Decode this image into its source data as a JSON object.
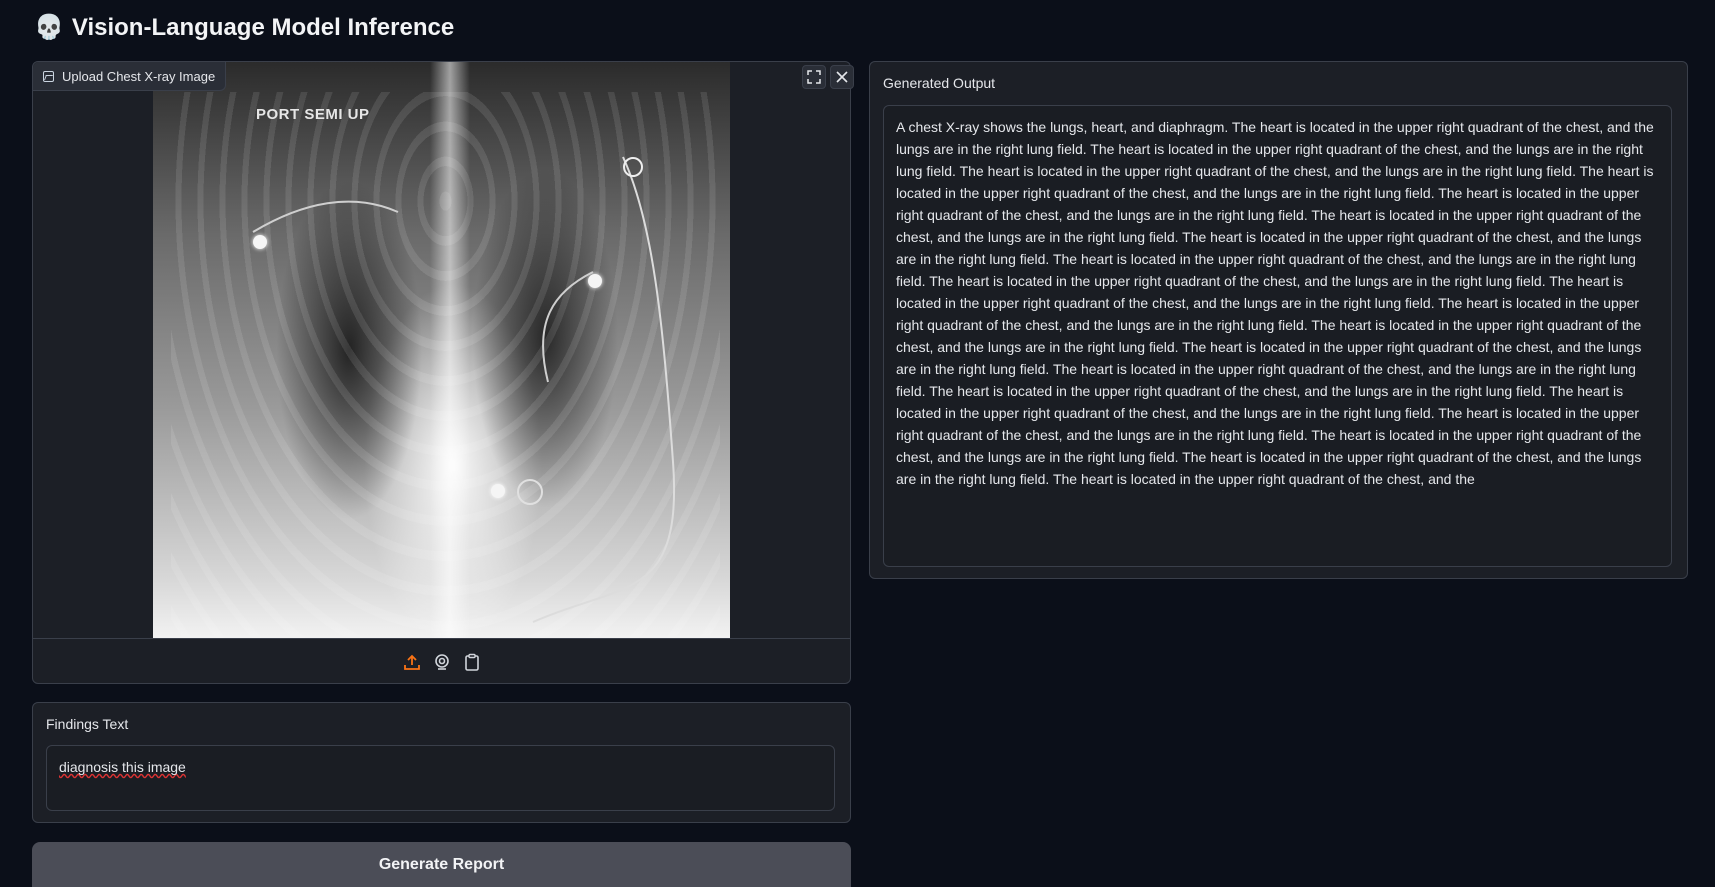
{
  "header": {
    "icon": "skull-icon",
    "title": "Vision-Language Model Inference"
  },
  "image_upload": {
    "label": "Upload Chest X-ray Image",
    "image_marker_text": "PORT SEMI UP",
    "toolbar_icons": [
      "upload-icon",
      "webcam-icon",
      "clipboard-icon"
    ],
    "accent_color": "#f97316"
  },
  "findings": {
    "label": "Findings Text",
    "value": "diagnosis this image"
  },
  "generate_button": {
    "label": "Generate Report"
  },
  "output": {
    "label": "Generated Output",
    "text": " A chest X-ray shows the lungs, heart, and diaphragm. The heart is located in the upper right quadrant of the chest, and the lungs are in the right lung field. The heart is located in the upper right quadrant of the chest, and the lungs are in the right lung field. The heart is located in the upper right quadrant of the chest, and the lungs are in the right lung field. The heart is located in the upper right quadrant of the chest, and the lungs are in the right lung field. The heart is located in the upper right quadrant of the chest, and the lungs are in the right lung field. The heart is located in the upper right quadrant of the chest, and the lungs are in the right lung field. The heart is located in the upper right quadrant of the chest, and the lungs are in the right lung field. The heart is located in the upper right quadrant of the chest, and the lungs are in the right lung field. The heart is located in the upper right quadrant of the chest, and the lungs are in the right lung field. The heart is located in the upper right quadrant of the chest, and the lungs are in the right lung field. The heart is located in the upper right quadrant of the chest, and the lungs are in the right lung field. The heart is located in the upper right quadrant of the chest, and the lungs are in the right lung field. The heart is located in the upper right quadrant of the chest, and the lungs are in the right lung field. The heart is located in the upper right quadrant of the chest, and the lungs are in the right lung field. The heart is located in the upper right quadrant of the chest, and the lungs are in the right lung field. The heart is located in the upper right quadrant of the chest, and the lungs are in the right lung field. The heart is located in the upper right quadrant of the chest, and the lungs are in the right lung field. The heart is located in the upper right quadrant of the chest, and the lungs are in the right lung field. The heart is located in the upper right quadrant of the chest, and the lungs are in the right lung field. The heart is located in the upper right quadrant of the chest, and the"
  }
}
